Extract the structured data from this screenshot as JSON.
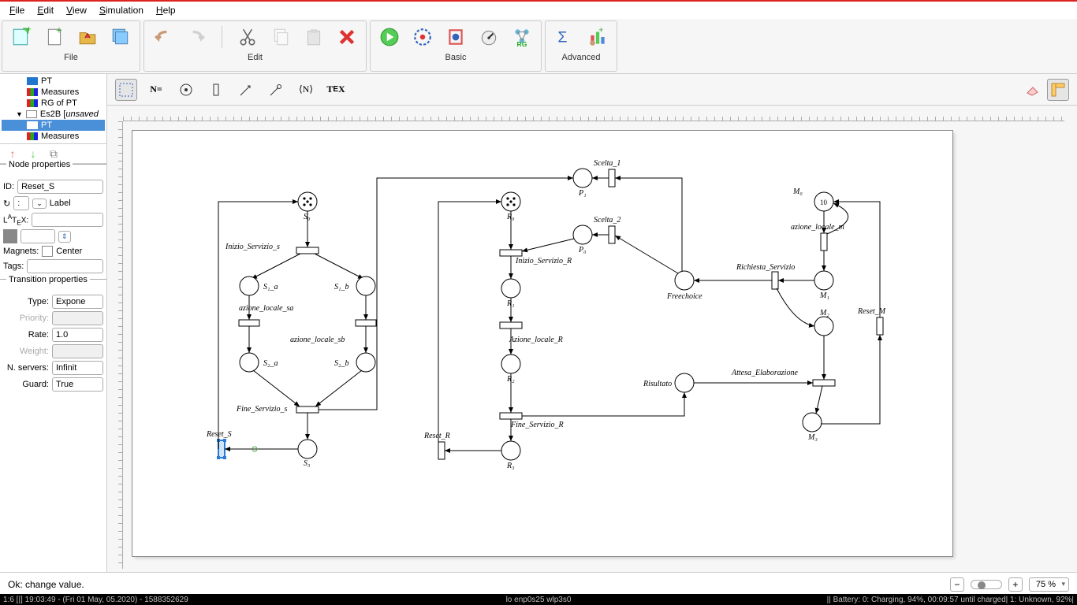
{
  "menu": {
    "file": "File",
    "edit": "Edit",
    "view": "View",
    "simulation": "Simulation",
    "help": "Help"
  },
  "toolgroups": {
    "file": "File",
    "edit": "Edit",
    "basic": "Basic",
    "advanced": "Advanced"
  },
  "tree": {
    "pt": "PT",
    "measures": "Measures",
    "rg": "RG of PT",
    "project": "Es2B [unsaved]",
    "project_pt": "PT",
    "project_measures": "Measures"
  },
  "node_props": {
    "section": "Node properties",
    "id_label": "ID:",
    "id_value": "Reset_S",
    "latex_label": "LᴬTᴇX:",
    "latex_value": "",
    "rotation_label": "↻",
    "rotation_value": ":",
    "label_label": "Label",
    "magnets_label": "Magnets:",
    "magnets_value": "Center",
    "tags_label": "Tags:",
    "tags_value": ""
  },
  "trans_props": {
    "section": "Transition properties",
    "type_label": "Type:",
    "type_value": "Exponential",
    "priority_label": "Priority:",
    "priority_value": "",
    "rate_label": "Rate:",
    "rate_value": "1.0",
    "weight_label": "Weight:",
    "weight_value": "",
    "servers_label": "N. servers:",
    "servers_value": "Infinite",
    "guard_label": "Guard:",
    "guard_value": "True"
  },
  "canvas_toolbar": {
    "n_label": "N=",
    "brackets": "⟨N⟩",
    "tex": "TᴇX"
  },
  "status": {
    "message": "Ok: change value.",
    "zoom": "75 %",
    "zoom_minus": "−",
    "zoom_plus": "+"
  },
  "osbar": {
    "left": "1:6 [|]    19:03:49 - (Fri 01 May, 05.2020) - 1588352629",
    "center": "lo enp0s25 wlp3s0",
    "right": "|| Battery: 0: Charging, 94%, 00:09:57 until charged| 1: Unknown, 92%|"
  },
  "petri": {
    "s0": "S₀",
    "s1a": "S₁_a",
    "s1b": "S₁_b",
    "s2a": "S₂_a",
    "s2b": "S₂_b",
    "s3": "S₃",
    "inizio_s": "Inizio_Servizio_s",
    "azione_sa": "azione_locale_sa",
    "azione_sb": "azione_locale_sb",
    "fine_s": "Fine_Servizio_s",
    "reset_s": "Reset_S",
    "r0": "R₀",
    "r1": "R₁",
    "r2": "R₂",
    "r3": "R₃",
    "inizio_r": "Inizio_Servizio_R",
    "azione_r": "Azione_locale_R",
    "fine_r": "Fine_Servizio_R",
    "reset_r": "Reset_R",
    "p0": "P₀",
    "p1": "P₁",
    "scelta1": "Scelta_1",
    "scelta2": "Scelta_2",
    "freechoice": "Freechoice",
    "richiesta": "Richiesta_Servizio",
    "risultato": "Risultato",
    "m0": "M₀",
    "m1": "M₁",
    "m2": "M₂",
    "m3": "M₃",
    "m0_tokens": "10",
    "azione_m": "azione_locale_m",
    "attesa": "Attesa_Elaborazione",
    "reset_m": "Reset_M"
  }
}
